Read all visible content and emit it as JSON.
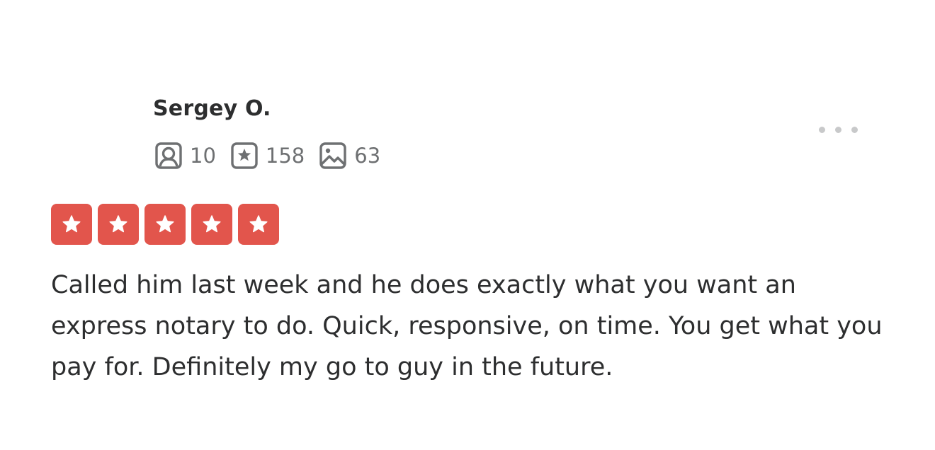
{
  "reviewer": {
    "name": "Sergey O.",
    "stats": [
      {
        "icon": "friends-icon",
        "value": "10"
      },
      {
        "icon": "reviews-icon",
        "value": "158"
      },
      {
        "icon": "photos-icon",
        "value": "63"
      }
    ]
  },
  "menu": {
    "icon": "more-options-icon"
  },
  "rating": {
    "stars": 5,
    "max": 5,
    "color": "#e2554c"
  },
  "review": {
    "text": "Called him last week and he does exactly what you want an express notary to do. Quick, responsive, on time. You get what you pay for. Definitely my go to guy in the future."
  }
}
